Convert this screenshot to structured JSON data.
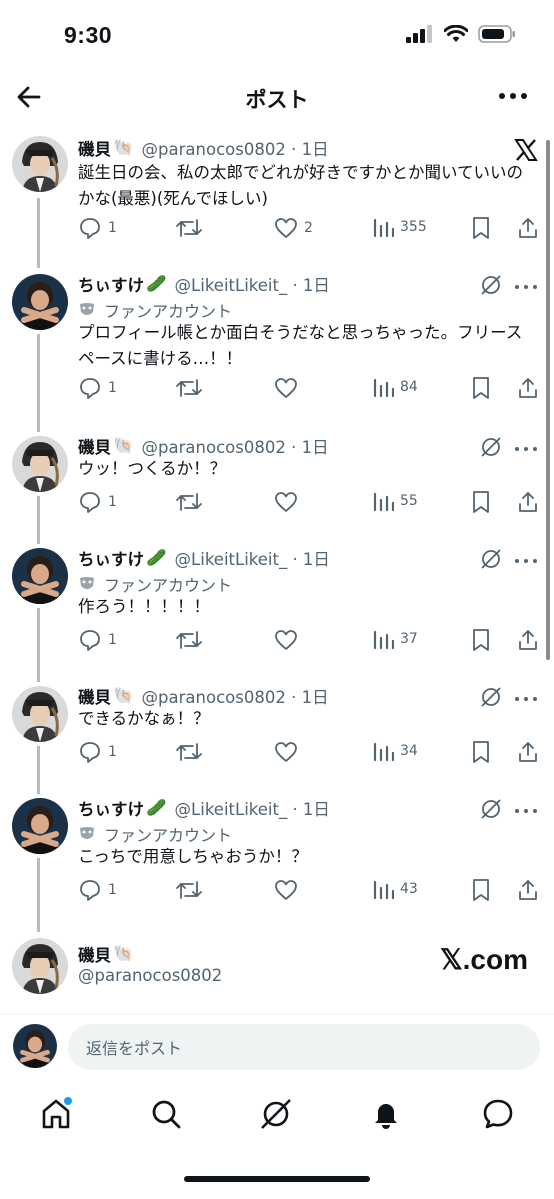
{
  "status": {
    "time": "9:30"
  },
  "nav": {
    "title": "ポスト"
  },
  "posts": [
    {
      "name": "磯貝",
      "handle": "@paranocos0802 · 1日",
      "text": "誕生日の会、私の太郎でどれが好きですかとか聞いていいのかな(最悪)(死んでほしい)",
      "replies": "1",
      "reposts": "",
      "likes": "2",
      "views": "355"
    },
    {
      "name": "ちぃすけ",
      "handle": "@LikeitLikeit_ · 1日",
      "badge": "ファンアカウント",
      "text": "プロフィール帳とか面白そうだなと思っちゃった。フリースペースに書ける…！！",
      "replies": "1",
      "reposts": "",
      "likes": "",
      "views": "84"
    },
    {
      "name": "磯貝",
      "handle": "@paranocos0802 · 1日",
      "text": "ウッ！つくるか！？",
      "replies": "1",
      "reposts": "",
      "likes": "",
      "views": "55"
    },
    {
      "name": "ちぃすけ",
      "handle": "@LikeitLikeit_ · 1日",
      "badge": "ファンアカウント",
      "text": "作ろう！！！！！",
      "replies": "1",
      "reposts": "",
      "likes": "",
      "views": "37"
    },
    {
      "name": "磯貝",
      "handle": "@paranocos0802 · 1日",
      "text": "できるかなぁ！？",
      "replies": "1",
      "reposts": "",
      "likes": "",
      "views": "34"
    },
    {
      "name": "ちぃすけ",
      "handle": "@LikeitLikeit_ · 1日",
      "badge": "ファンアカウント",
      "text": "こっちで用意しちゃおうか！？",
      "replies": "1",
      "reposts": "",
      "likes": "",
      "views": "43"
    }
  ],
  "footer_card": {
    "name": "磯貝",
    "handle": "@paranocos0802",
    "brand": "𝕏.com"
  },
  "reply": {
    "placeholder": "返信をポスト"
  },
  "colors": {
    "accent": "#1d9bf0",
    "text": "#0f1419",
    "muted": "#536471",
    "thread_line": "#b5bcc3"
  }
}
